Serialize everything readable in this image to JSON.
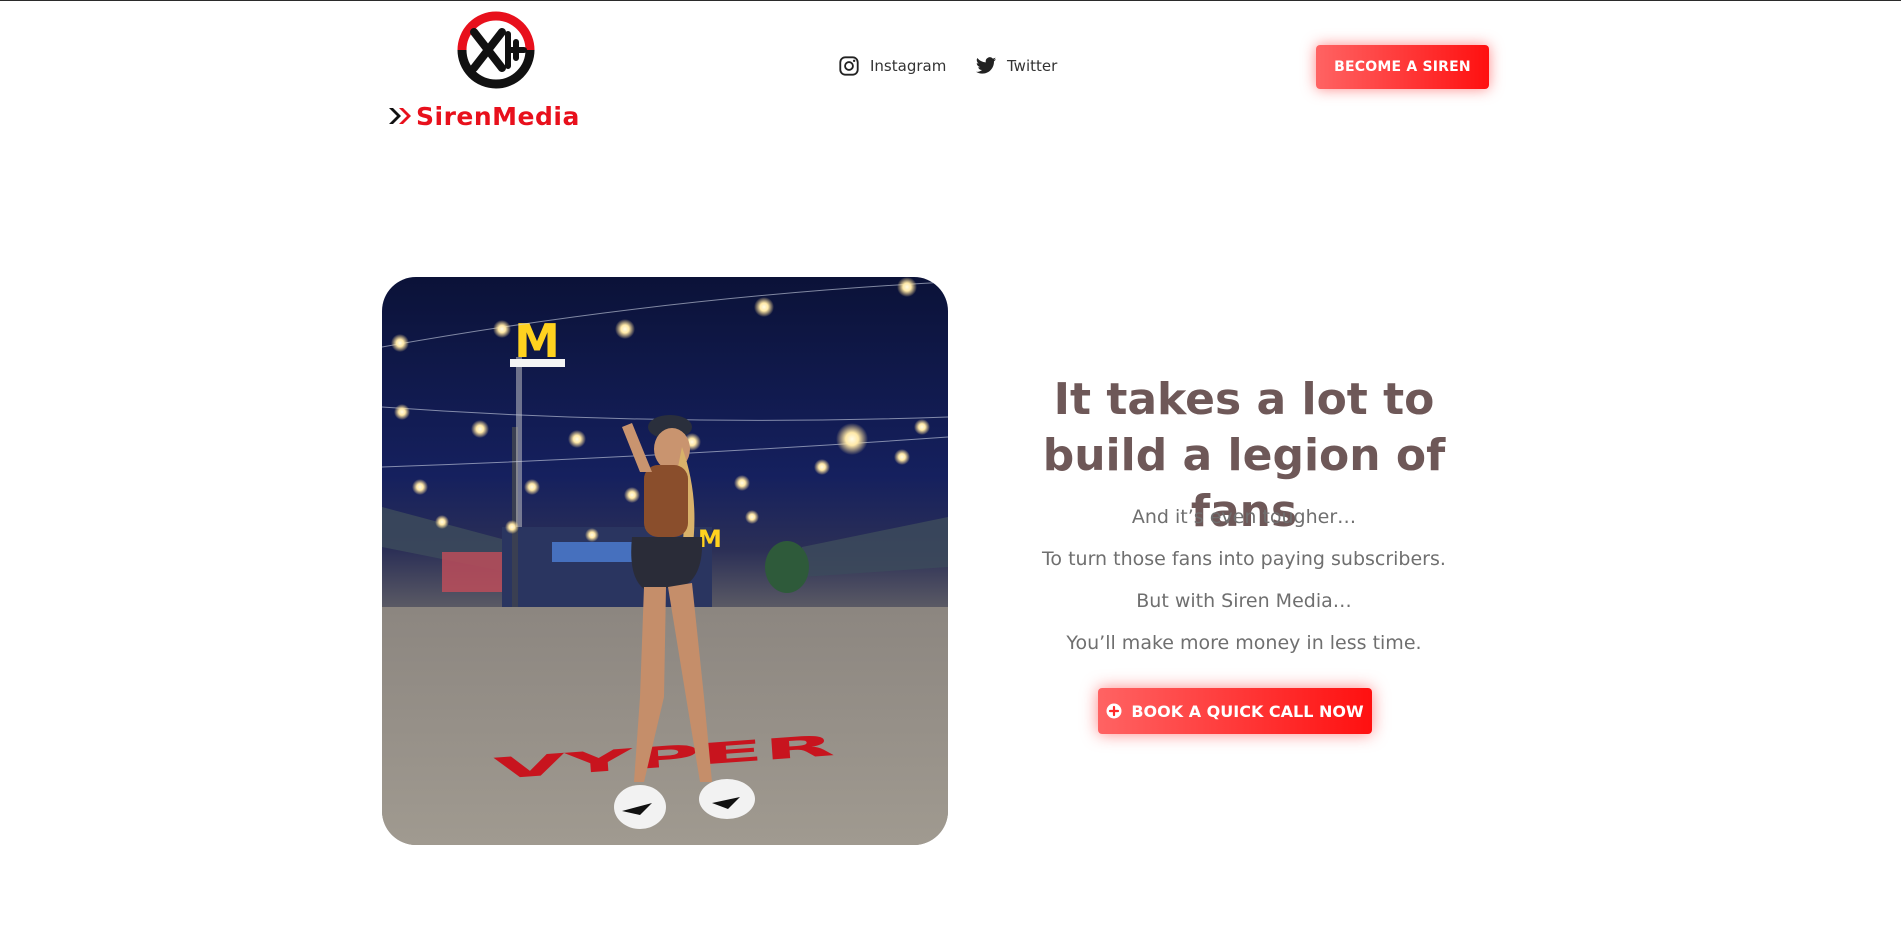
{
  "brand": {
    "logo_mark_text": "XG",
    "logo_wordmark": "SirenMedia",
    "colors": {
      "accent": "#e8101c",
      "accent_light": "#ff6363",
      "heading": "#6e5858",
      "body_text": "#6f6f6f"
    }
  },
  "nav": {
    "social": [
      {
        "label": "Instagram",
        "icon": "instagram-icon"
      },
      {
        "label": "Twitter",
        "icon": "twitter-icon"
      }
    ],
    "cta_label": "BECOME A SIREN"
  },
  "hero": {
    "heading": "It takes a lot to build a legion of fans",
    "lines": [
      "And it’s even tougher…",
      "To turn those fans into paying subscribers.",
      "But with Siren Media…",
      "You’ll make more money in less time."
    ],
    "cta_label": "BOOK A QUICK CALL NOW",
    "cta_icon": "plus-circle-icon",
    "image": {
      "ground_text": "VYPER",
      "sign_text": "M"
    }
  }
}
